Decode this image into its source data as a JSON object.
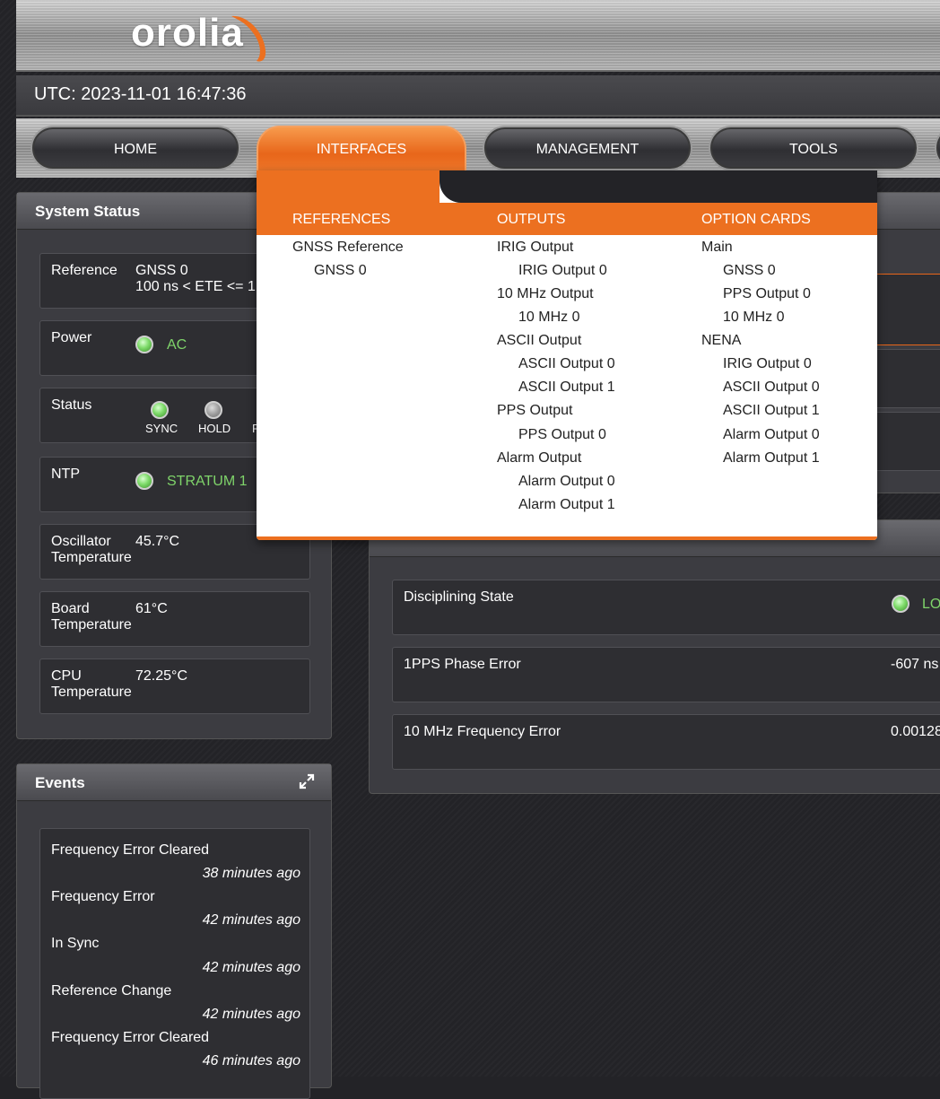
{
  "header": {
    "logo_text": "orolia"
  },
  "utc": {
    "label": "UTC: 2023-11-01 16:47:36"
  },
  "nav": {
    "items": [
      {
        "label": "HOME"
      },
      {
        "label": "INTERFACES"
      },
      {
        "label": "MANAGEMENT"
      },
      {
        "label": "TOOLS"
      }
    ]
  },
  "system_status": {
    "title": "System Status",
    "reference": {
      "label": "Reference",
      "value1": "GNSS 0",
      "value2": "100 ns < ETE <= 1"
    },
    "power": {
      "label": "Power",
      "value": "AC"
    },
    "status": {
      "label": "Status",
      "leds": [
        "SYNC",
        "HOLD",
        "F"
      ]
    },
    "ntp": {
      "label": "NTP",
      "value": "STRATUM 1"
    },
    "oscillator": {
      "label1": "Oscillator",
      "label2": "Temperature",
      "value": "45.7°C"
    },
    "board": {
      "label1": "Board",
      "label2": "Temperature",
      "value": "61°C"
    },
    "cpu": {
      "label1": "CPU",
      "label2": "Temperature",
      "value": "72.25°C"
    }
  },
  "events": {
    "title": "Events",
    "items": [
      {
        "title": "Frequency Error Cleared",
        "time": "38 minutes ago"
      },
      {
        "title": "Frequency Error",
        "time": "42 minutes ago"
      },
      {
        "title": "In Sync",
        "time": "42 minutes ago"
      },
      {
        "title": "Reference Change",
        "time": "42 minutes ago"
      },
      {
        "title": "Frequency Error Cleared",
        "time": "46 minutes ago"
      }
    ]
  },
  "disciplining": {
    "rows": [
      {
        "label": "Disciplining State",
        "value": "LO"
      },
      {
        "label": "1PPS Phase Error",
        "value": "-607 ns"
      },
      {
        "label": "10 MHz Frequency Error",
        "value": "0.00128"
      }
    ]
  },
  "dropdown": {
    "columns": [
      {
        "heading": "REFERENCES",
        "items": [
          {
            "label": "GNSS Reference",
            "level": 0
          },
          {
            "label": "GNSS 0",
            "level": 1
          }
        ]
      },
      {
        "heading": "OUTPUTS",
        "items": [
          {
            "label": "IRIG Output",
            "level": 0
          },
          {
            "label": "IRIG Output 0",
            "level": 1
          },
          {
            "label": "10 MHz Output",
            "level": 0
          },
          {
            "label": "10 MHz 0",
            "level": 1
          },
          {
            "label": "ASCII Output",
            "level": 0
          },
          {
            "label": "ASCII Output 0",
            "level": 1
          },
          {
            "label": "ASCII Output 1",
            "level": 1
          },
          {
            "label": "PPS Output",
            "level": 0
          },
          {
            "label": "PPS Output 0",
            "level": 1
          },
          {
            "label": "Alarm Output",
            "level": 0
          },
          {
            "label": "Alarm Output 0",
            "level": 1
          },
          {
            "label": "Alarm Output 1",
            "level": 1
          }
        ]
      },
      {
        "heading": "OPTION CARDS",
        "items": [
          {
            "label": "Main",
            "level": 0
          },
          {
            "label": "GNSS 0",
            "level": 1
          },
          {
            "label": "PPS Output 0",
            "level": 1
          },
          {
            "label": "10 MHz 0",
            "level": 1
          },
          {
            "label": "NENA",
            "level": 0
          },
          {
            "label": "IRIG Output 0",
            "level": 1
          },
          {
            "label": "ASCII Output 0",
            "level": 1
          },
          {
            "label": "ASCII Output 1",
            "level": 1
          },
          {
            "label": "Alarm Output 0",
            "level": 1
          },
          {
            "label": "Alarm Output 1",
            "level": 1
          }
        ]
      }
    ]
  },
  "colors": {
    "accent": "#ec7020",
    "led_green": "#7edb6a",
    "status_green": "#7fd46a",
    "panel": "#3c3c41"
  }
}
